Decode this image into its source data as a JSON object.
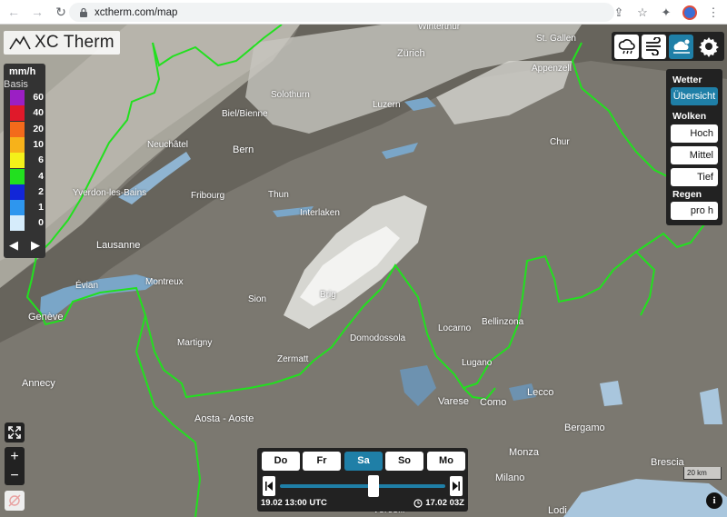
{
  "browser": {
    "url": "xctherm.com/map"
  },
  "app": {
    "logo_text": "XC Therm"
  },
  "legend": {
    "unit": "mm/h",
    "unit_sub": "Basis",
    "items": [
      {
        "label": "60",
        "color": "#9b1fc4"
      },
      {
        "label": "40",
        "color": "#e0192a"
      },
      {
        "label": "20",
        "color": "#f36a1b"
      },
      {
        "label": "10",
        "color": "#f7b21a"
      },
      {
        "label": "6",
        "color": "#f4f11a"
      },
      {
        "label": "4",
        "color": "#22e01f"
      },
      {
        "label": "2",
        "color": "#1226d8"
      },
      {
        "label": "1",
        "color": "#2e96ee"
      },
      {
        "label": "0",
        "color": "#d6ecfb"
      }
    ]
  },
  "panel": {
    "wetter_title": "Wetter",
    "wetter_btn": "Übersicht",
    "wolken_title": "Wolken",
    "wolken_btns": [
      "Hoch",
      "Mittel",
      "Tief"
    ],
    "regen_title": "Regen",
    "regen_btn": "pro h"
  },
  "timebar": {
    "days": [
      "Do",
      "Fr",
      "Sa",
      "So",
      "Mo"
    ],
    "selected_day": "Sa",
    "time_left": "19.02 13:00 UTC",
    "time_right": "17.02 03Z"
  },
  "scale": {
    "label": "20 km"
  },
  "zoom": {
    "plus": "+",
    "minus": "−"
  },
  "cities": {
    "zurich": "Zürich",
    "winterthur": "Winterthur",
    "bern": "Bern",
    "lausanne": "Lausanne",
    "geneve": "Genève",
    "annecy": "Annecy",
    "aosta": "Aosta - Aoste",
    "varese": "Varese",
    "como": "Como",
    "lecco": "Lecco",
    "bergamo": "Bergamo",
    "monza": "Monza",
    "milano": "Milano",
    "brescia": "Brescia",
    "lodi": "Lodi",
    "vercelli": "Vercelli",
    "brig": "Brig",
    "zermatt": "Zermatt",
    "neuchatel": "Neuchâtel",
    "biel": "Biel/Bienne",
    "solothurn": "Solothurn",
    "thun": "Thun",
    "interlaken": "Interlaken",
    "chur": "Chur",
    "sion": "Sion",
    "martigny": "Martigny",
    "montreux": "Montreux",
    "evian": "Évian",
    "yverdon": "Yverdon-les-Bains",
    "fribourg": "Fribourg",
    "luzern": "Luzern",
    "stgallen": "St. Gallen",
    "appenzell": "Appenzell",
    "bellinzona": "Bellinzona",
    "locarno": "Locarno",
    "lugano": "Lugano",
    "domodossola": "Domodossola"
  },
  "colors": {
    "accent": "#1f7fa7",
    "border_green": "#22e01f",
    "panel_bg": "#222222"
  }
}
